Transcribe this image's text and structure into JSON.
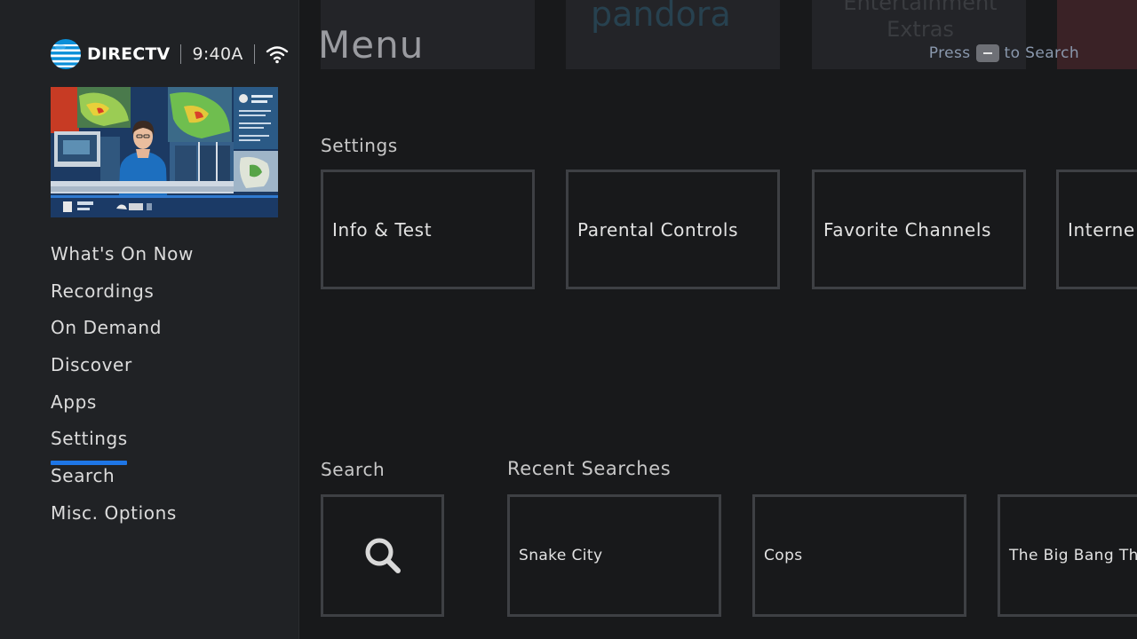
{
  "brand": {
    "name": "DIRECTV",
    "time": "9:40A"
  },
  "sidebar": {
    "items": [
      {
        "label": "What's On Now"
      },
      {
        "label": "Recordings"
      },
      {
        "label": "On Demand"
      },
      {
        "label": "Discover"
      },
      {
        "label": "Apps"
      },
      {
        "label": "Settings",
        "active": true
      },
      {
        "label": "Search"
      },
      {
        "label": "Misc. Options"
      }
    ]
  },
  "main": {
    "title": "Menu",
    "hint": {
      "before": "Press",
      "after": "to Search"
    },
    "ghost_row": {
      "apps": [
        "pandora",
        "Entertainment Extras"
      ]
    },
    "settings": {
      "label": "Settings",
      "tiles": [
        {
          "label": "Info & Test"
        },
        {
          "label": "Parental Controls"
        },
        {
          "label": "Favorite Channels"
        },
        {
          "label": "Interne"
        }
      ]
    },
    "search": {
      "label": "Search",
      "icon": "search-icon"
    },
    "recent_searches": {
      "label": "Recent Searches",
      "items": [
        {
          "label": "Snake City"
        },
        {
          "label": "Cops"
        },
        {
          "label": "The Big Bang Th"
        }
      ]
    }
  },
  "colors": {
    "accent": "#1e76e6",
    "background": "#18191b",
    "sidebar": "#202225",
    "tile_border": "#3e4044",
    "hint_text": "#8a98ad"
  }
}
